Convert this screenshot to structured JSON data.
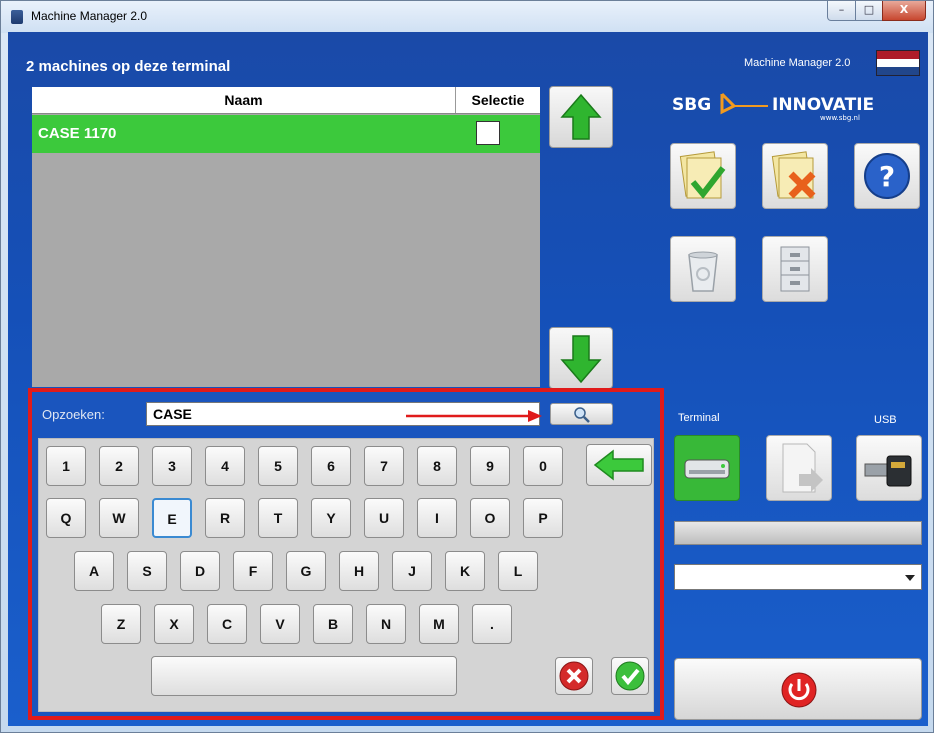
{
  "window": {
    "title": "Machine Manager 2.0",
    "controls": {
      "minimize": "–",
      "maximize": "□",
      "close": "X"
    }
  },
  "header": {
    "machines_text": "2 machines op deze terminal",
    "app_version": "Machine Manager 2.0",
    "flag_colors": [
      "#ae1c28",
      "#ffffff",
      "#21468b"
    ]
  },
  "logo": {
    "brand": "SBG",
    "name": "INNOVATIE",
    "url": "www.sbg.nl"
  },
  "table": {
    "columns": {
      "naam": "Naam",
      "selectie": "Selectie"
    },
    "rows": [
      {
        "name": "CASE 1170",
        "selected": false
      }
    ]
  },
  "search": {
    "label": "Opzoeken:",
    "value": "CASE"
  },
  "keyboard": {
    "row1": [
      "1",
      "2",
      "3",
      "4",
      "5",
      "6",
      "7",
      "8",
      "9",
      "0"
    ],
    "row2": [
      "Q",
      "W",
      "E",
      "R",
      "T",
      "Y",
      "U",
      "I",
      "O",
      "P"
    ],
    "row3": [
      "A",
      "S",
      "D",
      "F",
      "G",
      "H",
      "J",
      "K",
      "L"
    ],
    "row4": [
      "Z",
      "X",
      "C",
      "V",
      "B",
      "N",
      "M",
      "."
    ],
    "focused_key": "E"
  },
  "transfer": {
    "terminal_label": "Terminal",
    "usb_label": "USB"
  },
  "colors": {
    "selected_row": "#3cc93c",
    "highlight_frame": "#e01b1b",
    "background": "#1a4aa8"
  }
}
